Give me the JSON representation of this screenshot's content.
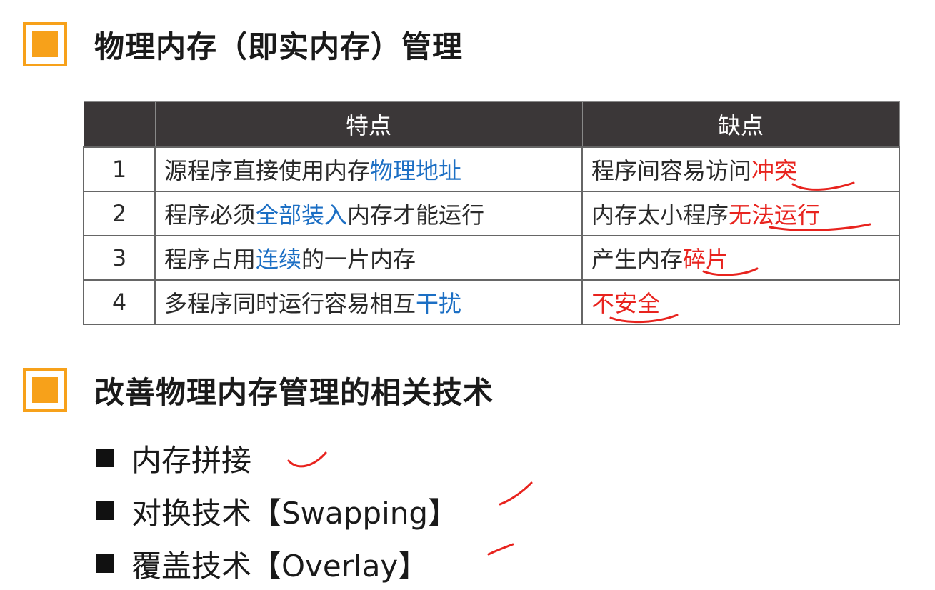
{
  "section1": {
    "title": "物理内存（即实内存）管理"
  },
  "table": {
    "headers": [
      "",
      "特点",
      "缺点"
    ],
    "rows": [
      {
        "num": "1",
        "feature_pre": "源程序直接使用内存",
        "feature_hl": "物理地址",
        "feature_post": "",
        "defect_pre": "程序间容易访问",
        "defect_hl": "冲突"
      },
      {
        "num": "2",
        "feature_pre": "程序必须",
        "feature_hl": "全部装入",
        "feature_post": "内存才能运行",
        "defect_pre": "内存太小程序",
        "defect_hl": "无法运行"
      },
      {
        "num": "3",
        "feature_pre": "程序占用",
        "feature_hl": "连续",
        "feature_post": "的一片内存",
        "defect_pre": "产生内存",
        "defect_hl": "碎片"
      },
      {
        "num": "4",
        "feature_pre": "多程序同时运行容易相互",
        "feature_hl": "干扰",
        "feature_post": "",
        "defect_pre": "",
        "defect_hl": "不安全"
      }
    ]
  },
  "section2": {
    "title": "改善物理内存管理的相关技术",
    "items": [
      "内存拼接",
      "对换技术【Swapping】",
      "覆盖技术【Overlay】"
    ]
  },
  "colors": {
    "accent": "#f7a11a",
    "header_bg": "#3b3738",
    "highlight_blue": "#1c6fc4",
    "highlight_red": "#e8231e"
  }
}
